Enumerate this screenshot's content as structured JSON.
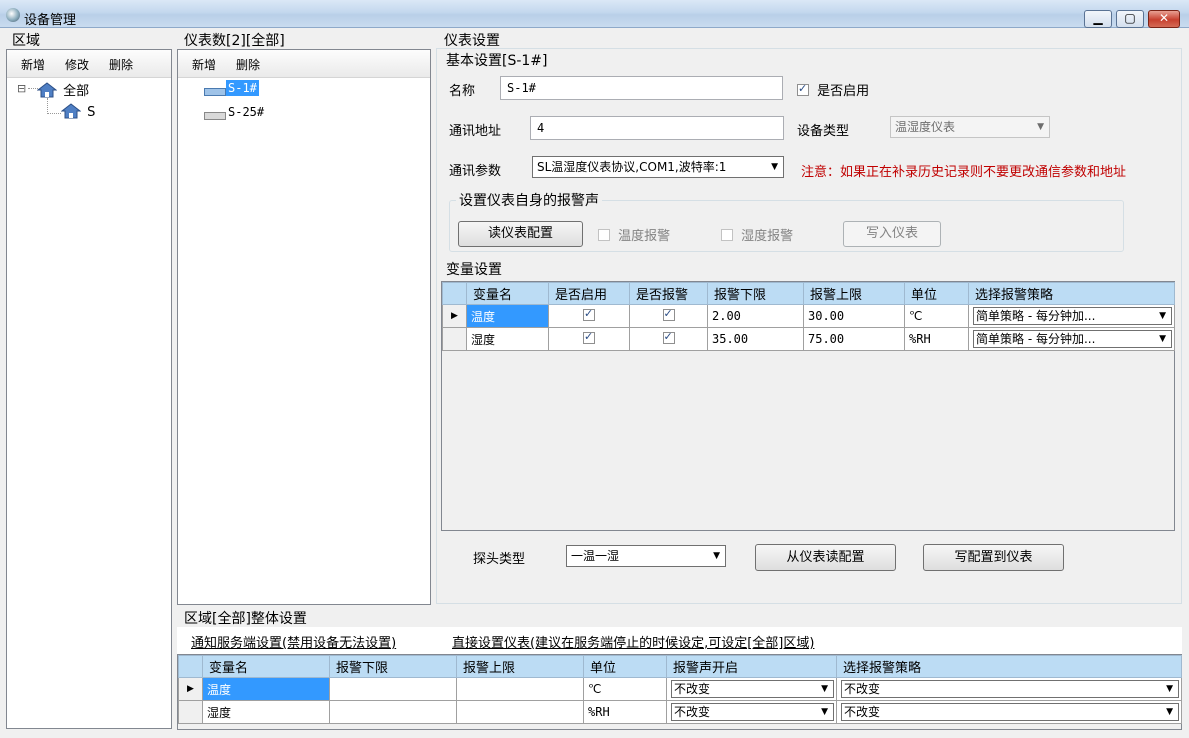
{
  "window": {
    "title": "设备管理"
  },
  "area": {
    "label": "区域",
    "toolbar": {
      "add": "新增",
      "edit": "修改",
      "delete": "删除"
    },
    "tree": {
      "root": "全部",
      "child": "S",
      "expander": "⊟"
    }
  },
  "meters": {
    "label": "仪表数[2][全部]",
    "toolbar": {
      "add": "新增",
      "delete": "删除"
    },
    "items": [
      "S-1#",
      "S-25#"
    ]
  },
  "settings": {
    "label": "仪表设置",
    "basic_label": "基本设置[S-1#]",
    "name_label": "名称",
    "name_value": "S-1#",
    "enabled_label": "是否启用",
    "address_label": "通讯地址",
    "address_value": "4",
    "device_type_label": "设备类型",
    "device_type_value": "温湿度仪表",
    "comm_label": "通讯参数",
    "comm_value": "SL温湿度仪表协议,COM1,波特率:1",
    "note": "注意：如果正在补录历史记录则不要更改通信参数和地址",
    "alarm_group_label": "设置仪表自身的报警声",
    "read_config_button": "读仪表配置",
    "temp_alarm_label": "温度报警",
    "humidity_alarm_label": "湿度报警",
    "write_meter_button": "写入仪表",
    "var_label": "变量设置",
    "var_columns": [
      "变量名",
      "是否启用",
      "是否报警",
      "报警下限",
      "报警上限",
      "单位",
      "选择报警策略"
    ],
    "var_rows": [
      {
        "name": "温度",
        "low": "2.00",
        "high": "30.00",
        "unit": "℃",
        "strategy": "简单策略 - 每分钟加..."
      },
      {
        "name": "湿度",
        "low": "35.00",
        "high": "75.00",
        "unit": "%RH",
        "strategy": "简单策略 - 每分钟加..."
      }
    ],
    "probe_label": "探头类型",
    "probe_value": "一温一湿",
    "read_from_meter_button": "从仪表读配置",
    "write_to_meter_button": "写配置到仪表"
  },
  "overall": {
    "label": "区域[全部]整体设置",
    "link_notify": "通知服务端设置(禁用设备无法设置)",
    "link_direct": "直接设置仪表(建议在服务端停止的时候设定,可设定[全部]区域)",
    "columns": [
      "变量名",
      "报警下限",
      "报警上限",
      "单位",
      "报警声开启",
      "选择报警策略"
    ],
    "rows": [
      {
        "name": "温度",
        "low": "",
        "high": "",
        "unit": "℃",
        "sound": "不改变",
        "strategy": "不改变"
      },
      {
        "name": "湿度",
        "low": "",
        "high": "",
        "unit": "%RH",
        "sound": "不改变",
        "strategy": "不改变"
      }
    ]
  }
}
